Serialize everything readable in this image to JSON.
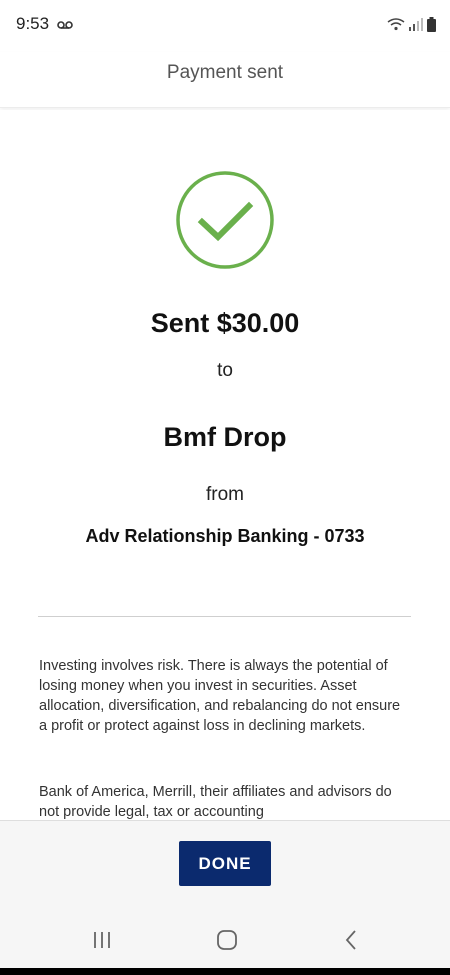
{
  "status_bar": {
    "time": "9:53",
    "icons": [
      "voicemail-icon",
      "wifi-icon",
      "signal-icon",
      "battery-icon"
    ]
  },
  "header": {
    "title": "Payment sent"
  },
  "confirmation": {
    "icon": "check-circle-icon",
    "amount_text": "Sent $30.00",
    "to_label": "to",
    "recipient": "Bmf Drop",
    "from_label": "from",
    "account": "Adv Relationship Banking - 0733"
  },
  "disclosures": [
    "Investing involves risk. There is always the potential of losing money when you invest in securities. Asset allocation, diversification, and rebalancing do not ensure a profit or protect against loss in declining markets.",
    "Bank of America, Merrill, their affiliates and advisors do not provide legal, tax or accounting"
  ],
  "footer": {
    "done_label": "DONE"
  },
  "nav": {
    "items": [
      "recents-icon",
      "home-icon",
      "back-icon"
    ]
  },
  "colors": {
    "accent_green": "#6ab04c",
    "button_navy": "#0b2a6e"
  }
}
